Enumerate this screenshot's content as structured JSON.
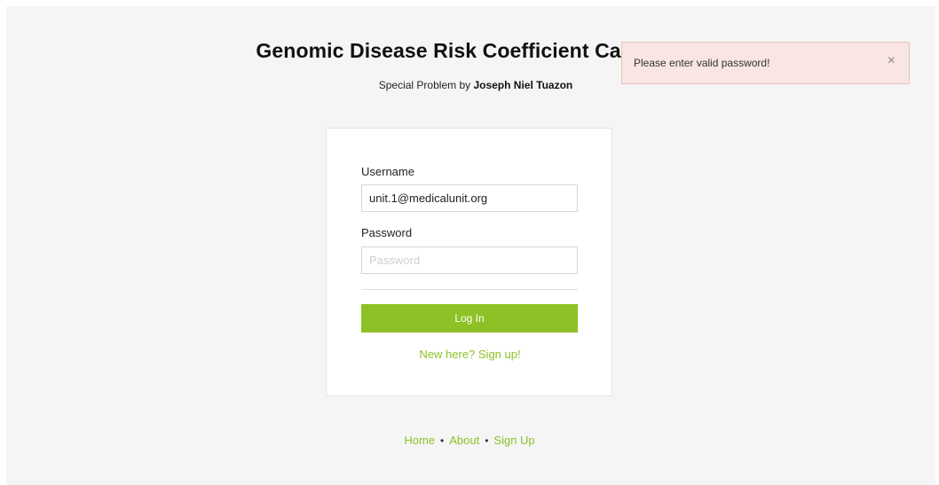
{
  "header": {
    "title": "Genomic Disease Risk Coefficient Calculator",
    "subtitle_prefix": "Special Problem by ",
    "author": "Joseph Niel Tuazon"
  },
  "login_form": {
    "username_label": "Username",
    "username_value": "unit.1@medicalunit.org",
    "password_label": "Password",
    "password_placeholder": "Password",
    "login_button": "Log In",
    "signup_link": "New here? Sign up!"
  },
  "alert": {
    "message": "Please enter valid password!",
    "close_glyph": "×"
  },
  "footer": {
    "links": [
      "Home",
      "About",
      "Sign Up"
    ],
    "separator": "•"
  },
  "colors": {
    "accent": "#8dc126",
    "alert_background": "#f9e5e1",
    "page_background": "#f5f5f5"
  }
}
